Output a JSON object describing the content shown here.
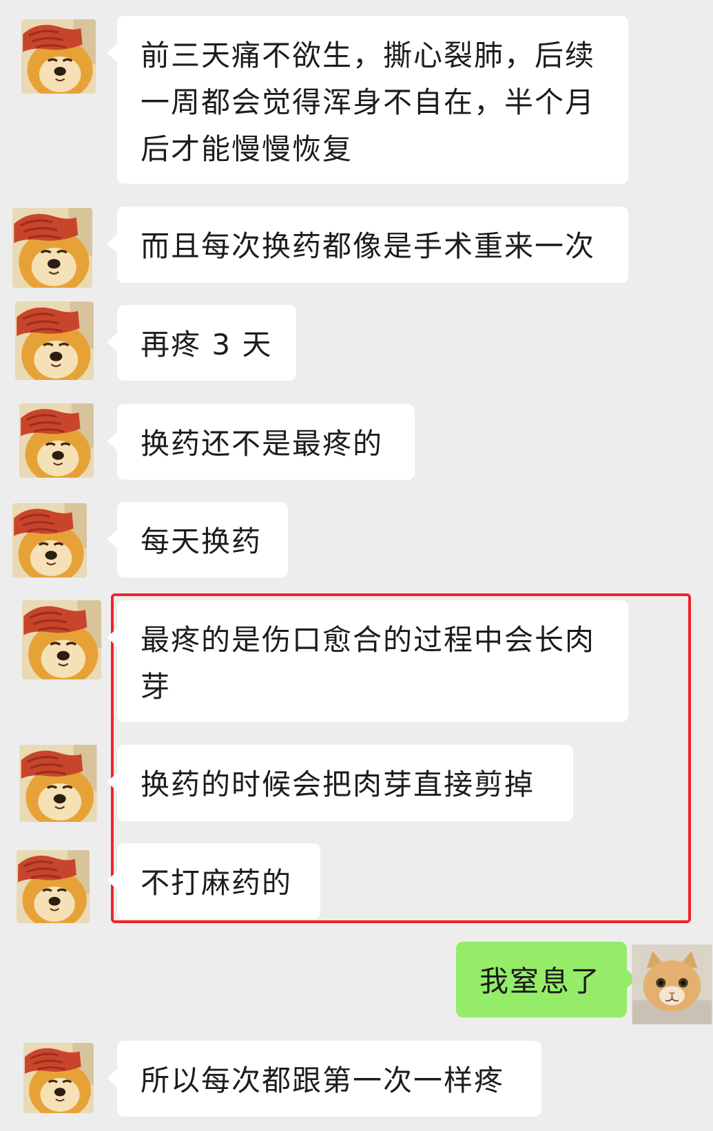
{
  "colors": {
    "background": "#ededed",
    "bubble_other": "#ffffff",
    "bubble_mine": "#95ec69",
    "highlight_border": "#f0242a"
  },
  "avatars": {
    "other": "shiba-dog-facepalm-avatar",
    "mine": "orange-cat-avatar"
  },
  "messages": [
    {
      "sender": "other",
      "text": "前三天痛不欲生，撕心裂肺，后续一周都会觉得浑身不自在，半个月后才能慢慢恢复"
    },
    {
      "sender": "other",
      "text": "而且每次换药都像是手术重来一次"
    },
    {
      "sender": "other",
      "text": "再疼 3 天"
    },
    {
      "sender": "other",
      "text": "换药还不是最疼的"
    },
    {
      "sender": "other",
      "text": "每天换药"
    },
    {
      "sender": "other",
      "text": "最疼的是伤口愈合的过程中会长肉芽"
    },
    {
      "sender": "other",
      "text": "换药的时候会把肉芽直接剪掉"
    },
    {
      "sender": "other",
      "text": "不打麻药的"
    },
    {
      "sender": "me",
      "text": "我窒息了"
    },
    {
      "sender": "other",
      "text": "所以每次都跟第一次一样疼"
    }
  ]
}
